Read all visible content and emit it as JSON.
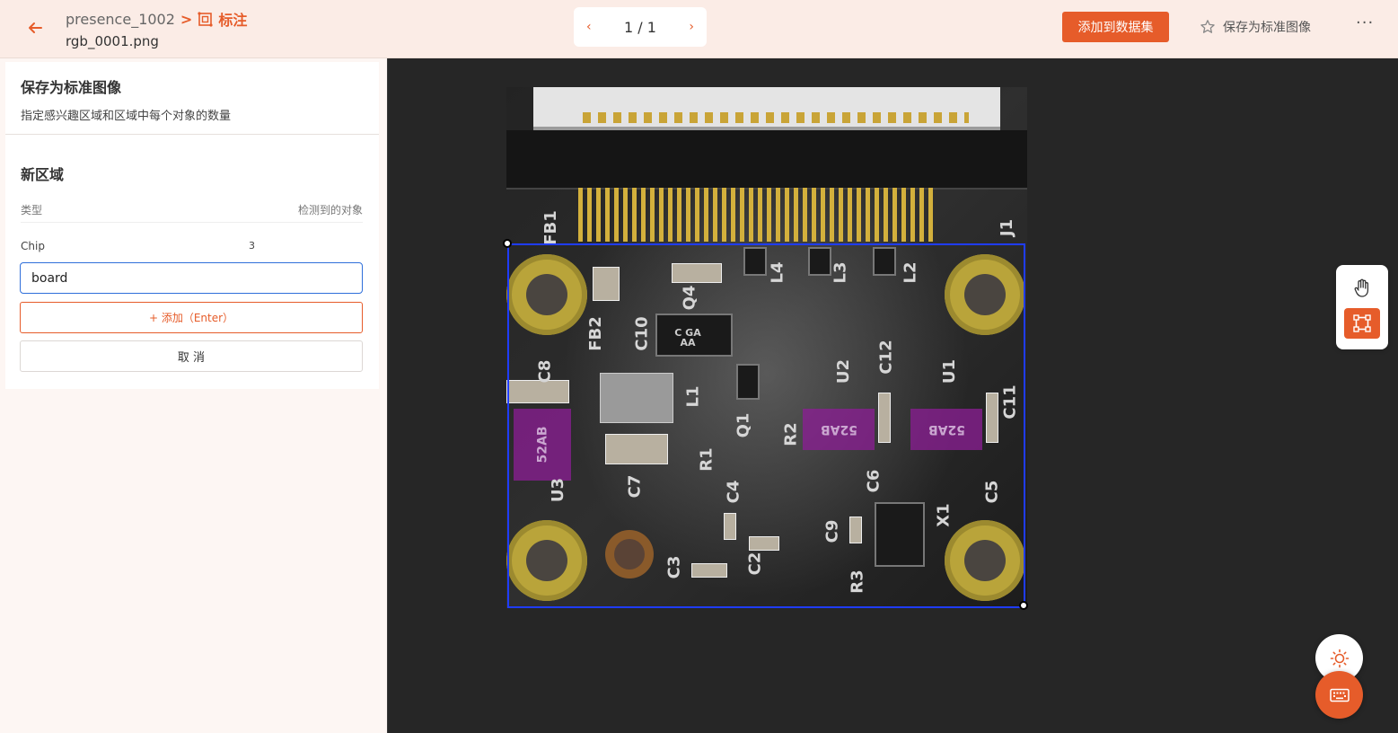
{
  "header": {
    "project": "presence_1002",
    "separator": ">",
    "current_page": "标注",
    "filename": "rgb_0001.png",
    "pager": {
      "prev": "‹",
      "text": "1 / 1",
      "next": "›"
    },
    "add_dataset_label": "添加到数据集",
    "save_standard_label": "保存为标准图像",
    "more": "···"
  },
  "left_panel": {
    "title": "保存为标准图像",
    "description": "指定感兴趣区域和区域中每个对象的数量",
    "section_title": "新区域",
    "col_type": "类型",
    "col_detected": "检测到的对象",
    "rows": [
      {
        "type": "Chip",
        "count": "3"
      }
    ],
    "input_value": "board",
    "add_label": "+ 添加（Enter）",
    "cancel_label": "取 消"
  },
  "canvas": {
    "chip_labels": [
      "52AB",
      "52AB",
      "52AB"
    ],
    "silk_labels": [
      "FB1",
      "J1",
      "L4",
      "L3",
      "L2",
      "Q4",
      "C8",
      "FB2",
      "C10",
      "L1",
      "Q1",
      "R2",
      "U2",
      "C12",
      "U1",
      "C11",
      "U3",
      "C7",
      "R1",
      "C4",
      "C6",
      "C5",
      "X1",
      "C3",
      "C2",
      "C9",
      "R3"
    ],
    "ic_label": "C GA AA"
  },
  "colors": {
    "accent": "#e65c2a",
    "bbox": "#1f3cff",
    "chip_overlay": "#8c1e96"
  },
  "icons": {
    "back": "arrow-left-icon",
    "annotate": "annotate-icon",
    "star": "star-outline-icon",
    "hand": "hand-pan-icon",
    "rect": "rectangle-select-icon",
    "brightness": "sun-icon",
    "keyboard": "keyboard-icon"
  }
}
